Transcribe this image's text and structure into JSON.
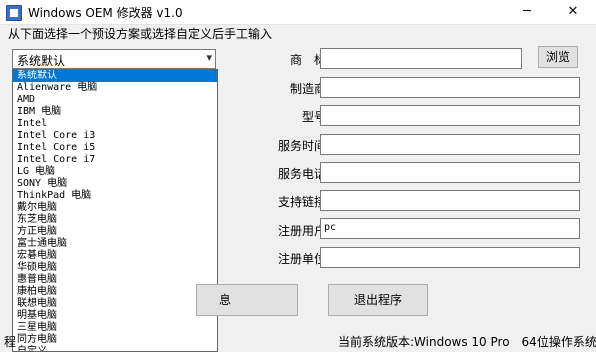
{
  "window": {
    "title": "Windows OEM 修改器 v1.0",
    "minimize": "─",
    "close": "✕"
  },
  "prompt": "从下面选择一个预设方案或选择自定义后手工输入",
  "preset": {
    "selected": "系统默认",
    "options": [
      "系统默认",
      "Alienware 电脑",
      "AMD",
      "IBM 电脑",
      "Intel",
      "Intel Core i3",
      "Intel Core i5",
      "Intel Core i7",
      "LG 电脑",
      "SONY 电脑",
      "ThinkPad 电脑",
      "戴尔电脑",
      "东芝电脑",
      "方正电脑",
      "富士通电脑",
      "宏碁电脑",
      "华硕电脑",
      "惠普电脑",
      "康柏电脑",
      "联想电脑",
      "明基电脑",
      "三星电脑",
      "同方电脑",
      "自定义"
    ]
  },
  "form": {
    "brand_label": "商　标:",
    "manufacturer_label": "制造商:",
    "model_label": "型号:",
    "service_hours_label": "服务时间:",
    "service_phone_label": "服务电话:",
    "support_link_label": "支持链接:",
    "registered_user_label": "注册用户:",
    "registered_org_label": "注册单位:",
    "brand_value": "",
    "manufacturer_value": "",
    "model_value": "",
    "service_hours_value": "",
    "service_phone_value": "",
    "support_link_value": "",
    "registered_user_value": "pc",
    "registered_org_value": ""
  },
  "buttons": {
    "browse": "浏览",
    "info_partial": "息",
    "exit": "退出程序"
  },
  "status": {
    "left_partial": "程",
    "system_version": "当前系统版本:Windows 10 Pro　64位操作系统"
  }
}
